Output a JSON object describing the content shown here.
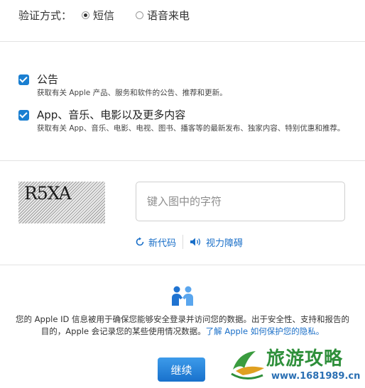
{
  "verify": {
    "label": "验证方式：",
    "options": [
      {
        "label": "短信",
        "selected": true
      },
      {
        "label": "语音来电",
        "selected": false
      }
    ]
  },
  "subscriptions": [
    {
      "title": "公告",
      "desc": "获取有关 Apple 产品、服务和软件的公告、推荐和更新。",
      "checked": true
    },
    {
      "title": "App、音乐、电影以及更多内容",
      "desc": "获取有关 App、音乐、电影、电视、图书、播客等的最新发布、独家内容、特别优惠和推荐。",
      "checked": true
    }
  ],
  "captcha": {
    "image_text": "R5XA",
    "placeholder": "键入图中的字符",
    "new_code_label": "新代码",
    "audio_label": "视力障碍"
  },
  "privacy": {
    "text": "您的 Apple ID 信息被用于确保您能够安全登录并访问您的数据。出于安全性、支持和报告的目的，Apple 会记录您的某些使用情况数据。",
    "link": "了解 Apple 如何保护您的隐私。"
  },
  "continue_label": "继续",
  "watermark": {
    "text": "旅游攻略",
    "url": "www.1681989.cn"
  },
  "colors": {
    "accent": "#1a7fd1",
    "link": "#1a6fc8",
    "watermark_green": "#2e8f3a"
  }
}
